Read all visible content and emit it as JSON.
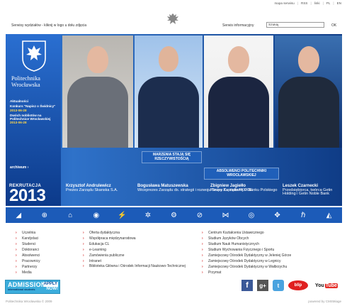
{
  "topnav": [
    "mapa serwisu",
    "RSS",
    "linki",
    "PL",
    "EN"
  ],
  "header": {
    "wydzialy_text": "Serwisy wydziałów - kliknij w logo u dołu zdjęcia",
    "serwis_label": "Serwis informacyjny",
    "search_placeholder": "Szukaj",
    "ok_label": "OK"
  },
  "banner": {
    "university_name_line1": "Politechnika",
    "university_name_line2": "Wrocławska",
    "news_heading": "Aktualności",
    "news": [
      {
        "title": "Konkurs \"Napisz o Świdnicy\"",
        "date": "2013-06-28"
      },
      {
        "title": "Dwóch noblistów na Politechnice Wrocławskiej",
        "date": "2013-06-28"
      }
    ],
    "archive_label": "archiwum",
    "recruitment_label": "REKRUTACJA",
    "recruitment_year": "2013",
    "slogan1": "MARZENIA STAJĄ SIĘ RZECZYWISTOŚCIĄ",
    "slogan2": "ABSOLWENCI POLITECHNIKI WROCŁAWSKIEJ",
    "people": [
      {
        "name": "Krzysztof Andrulewicz",
        "role": "Prezes Zarządu Skanska S.A."
      },
      {
        "name": "Bogusława Matuszewska",
        "role": "Wiceprezes Zarządu ds. strategii i rozwoju Grupy Kapitałowej PGE"
      },
      {
        "name": "Zbigniew Jagiełło",
        "role": "Prezes Zarządu PKO Banku Polskiego"
      },
      {
        "name": "Leszek Czarnecki",
        "role": "Przedsiębiorca, twórca Getin Holding i Getin Noble Bank"
      }
    ]
  },
  "links": {
    "col1": [
      "Uczelnia",
      "Kandydaci",
      "Studenci",
      "Doktoranci",
      "Absolwenci",
      "Pracownicy",
      "Partnerzy",
      "Media"
    ],
    "col2": [
      "Oferta dydaktyczna",
      "Współpraca międzynarodowa",
      "Edukacja CL",
      "e-Learning",
      "Zamówienia publiczne",
      "Intranet",
      "Biblioteka Główna i Ośrodek Informacji Naukowo-Technicznej"
    ],
    "col3": [
      "Centrum Kształcenia Ustawicznego",
      "Studium Języków Obcych",
      "Studium Nauk Humanistycznych",
      "Studium Wychowania Fizycznego i Sportu",
      "Zamiejscowy Ośrodek Dydaktyczny w Jeleniej Górze",
      "Zamiejscowy Ośrodek Dydaktyczny w Legnicy",
      "Zamiejscowy Ośrodek Dydaktyczny w Wałbrzychu",
      "Przymat"
    ]
  },
  "admission": {
    "title": "ADMISSION",
    "subtitle": "international students",
    "apply": "APPLY",
    "now": "NOW!"
  },
  "social": {
    "facebook": "f",
    "googleplus": "g+",
    "twitter": "t",
    "blip": "blip",
    "youtube_you": "You",
    "youtube_tube": "Tube"
  },
  "footer": {
    "copyright": "Politechnika Wrocławska © 2009",
    "powered": "powered by CMSMiage"
  },
  "colors": {
    "banner_blue": "#1c5bb8",
    "news_date": "#ffd84a",
    "link_bullet": "#cc0000"
  }
}
